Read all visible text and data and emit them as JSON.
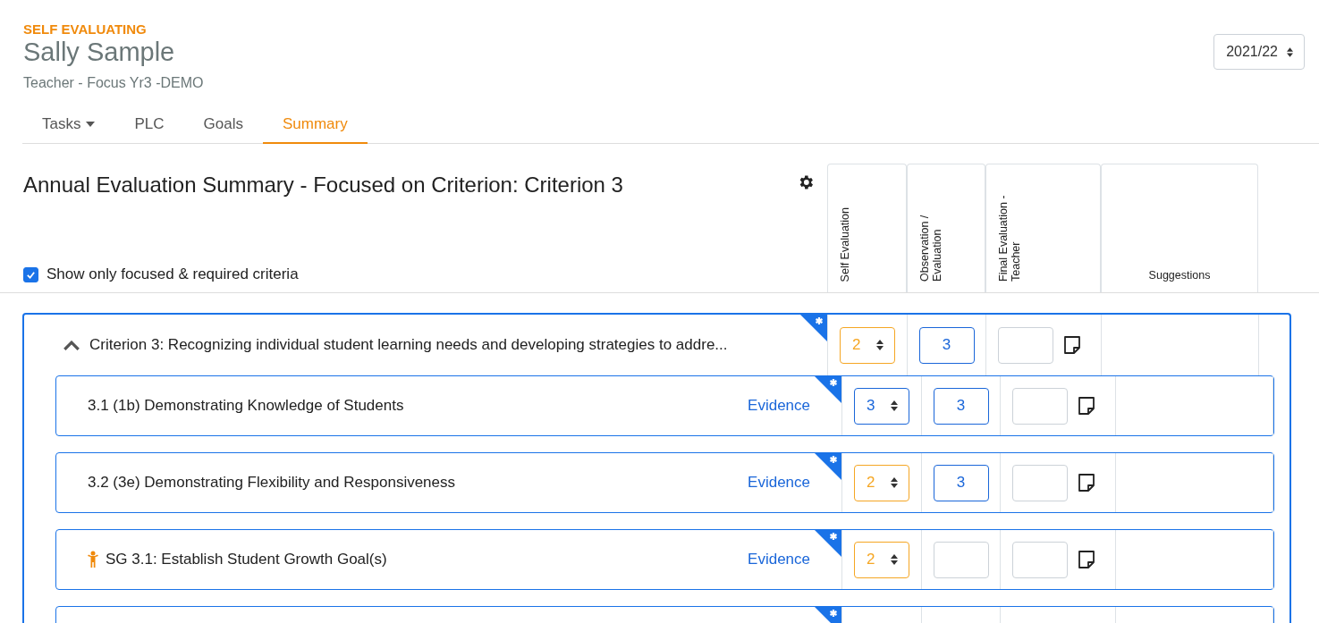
{
  "header": {
    "status": "SELF EVALUATING",
    "name": "Sally Sample",
    "subtitle": "Teacher - Focus Yr3 -DEMO",
    "year_select": {
      "value": "2021/22"
    }
  },
  "tabs": [
    {
      "label": "Tasks",
      "dropdown": true,
      "selected": false
    },
    {
      "label": "PLC",
      "dropdown": false,
      "selected": false
    },
    {
      "label": "Goals",
      "dropdown": false,
      "selected": false
    },
    {
      "label": "Summary",
      "dropdown": false,
      "selected": true
    }
  ],
  "summary": {
    "title": "Annual Evaluation Summary - Focused on Criterion: Criterion 3",
    "show_focused": {
      "label": "Show only focused & required criteria",
      "checked": true
    },
    "columns": [
      {
        "label": "Self Evaluation",
        "rotated": true
      },
      {
        "label": "Observation / Evaluation",
        "rotated": true
      },
      {
        "label": "Final Evaluation - Teacher",
        "rotated": true
      },
      {
        "label": "Suggestions",
        "rotated": false
      }
    ],
    "criterion": {
      "title": "Criterion 3: Recognizing individual student learning needs and developing strategies to addre...",
      "expanded": true,
      "required": true,
      "self_evaluation": "2",
      "color": "#f5a623",
      "observation": "3",
      "more_rows_below": true,
      "rows": [
        {
          "kind": "component",
          "title": "3.1 (1b) Demonstrating Knowledge of Students",
          "link": "Evidence",
          "required": true,
          "self_evaluation": "3",
          "color": "#1a66d9",
          "observation": "3"
        },
        {
          "kind": "component",
          "title": "3.2 (3e) Demonstrating Flexibility and Responsiveness",
          "link": "Evidence",
          "required": true,
          "self_evaluation": "2",
          "color": "#f5a623",
          "observation": "3"
        },
        {
          "kind": "goal",
          "title": "SG 3.1: Establish Student Growth Goal(s)",
          "link": "Evidence",
          "required": true,
          "self_evaluation": "2",
          "color": "#f5a623"
        }
      ]
    }
  }
}
